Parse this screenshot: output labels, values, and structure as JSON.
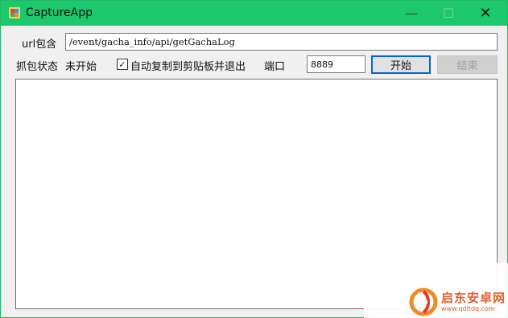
{
  "window": {
    "title": "CaptureApp",
    "minimize_glyph": "—",
    "maximize_glyph": "☐",
    "close_glyph": "✕",
    "accent_color": "#1dc76b"
  },
  "form": {
    "url_label": "url包含",
    "url_value": "/event/gacha_info/api/getGachaLog",
    "capture_state_label": "抓包状态",
    "capture_state_value": "未开始",
    "auto_copy_checked": true,
    "auto_copy_checkmark": "✓",
    "auto_copy_label": "自动复制到剪贴板并退出",
    "port_label": "端口",
    "port_value": "8889",
    "start_button": "开始",
    "stop_button": "结束"
  },
  "log": {
    "content": ""
  },
  "watermark": {
    "brand": "启东安卓网",
    "url": "www.qdltdq.com"
  }
}
